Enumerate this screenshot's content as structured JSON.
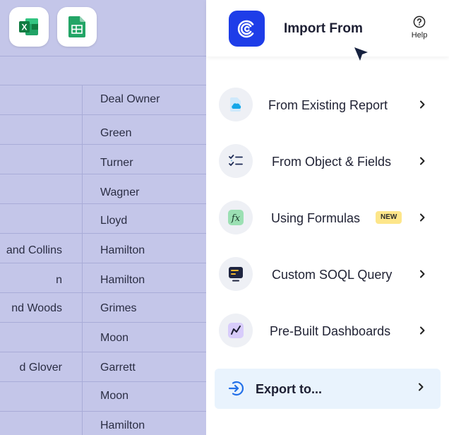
{
  "sheet": {
    "apps": [
      {
        "icon": "excel-icon",
        "label": "X"
      },
      {
        "icon": "google-sheets-icon"
      }
    ],
    "column_header": "Deal Owner",
    "rows": [
      {
        "left": "",
        "right": "Green"
      },
      {
        "left": "",
        "right": "Turner"
      },
      {
        "left": "",
        "right": "Wagner"
      },
      {
        "left": "",
        "right": "Lloyd"
      },
      {
        "left": "and Collins",
        "right": "Hamilton"
      },
      {
        "left": "n",
        "right": "Hamilton"
      },
      {
        "left": "nd Woods",
        "right": "Grimes"
      },
      {
        "left": "",
        "right": "Moon"
      },
      {
        "left": "d Glover",
        "right": "Garrett"
      },
      {
        "left": "",
        "right": "Moon"
      },
      {
        "left": "",
        "right": "Hamilton"
      }
    ]
  },
  "panel": {
    "title": "Import From",
    "help_label": "Help",
    "items": [
      {
        "label": "From Existing Report",
        "icon": "salesforce-cloud-icon"
      },
      {
        "label": "From Object & Fields",
        "icon": "checklist-icon"
      },
      {
        "label": "Using Formulas",
        "icon": "formula-fx-icon",
        "badge": "NEW"
      },
      {
        "label": "Custom SOQL Query",
        "icon": "terminal-icon"
      },
      {
        "label": "Pre-Built Dashboards",
        "icon": "chart-line-icon"
      }
    ],
    "export_label": "Export to..."
  },
  "colors": {
    "sheet_bg": "#c4c6e9",
    "brand": "#1e3de8",
    "export_bg": "#e9f3fd",
    "badge_bg": "#fde68a"
  }
}
